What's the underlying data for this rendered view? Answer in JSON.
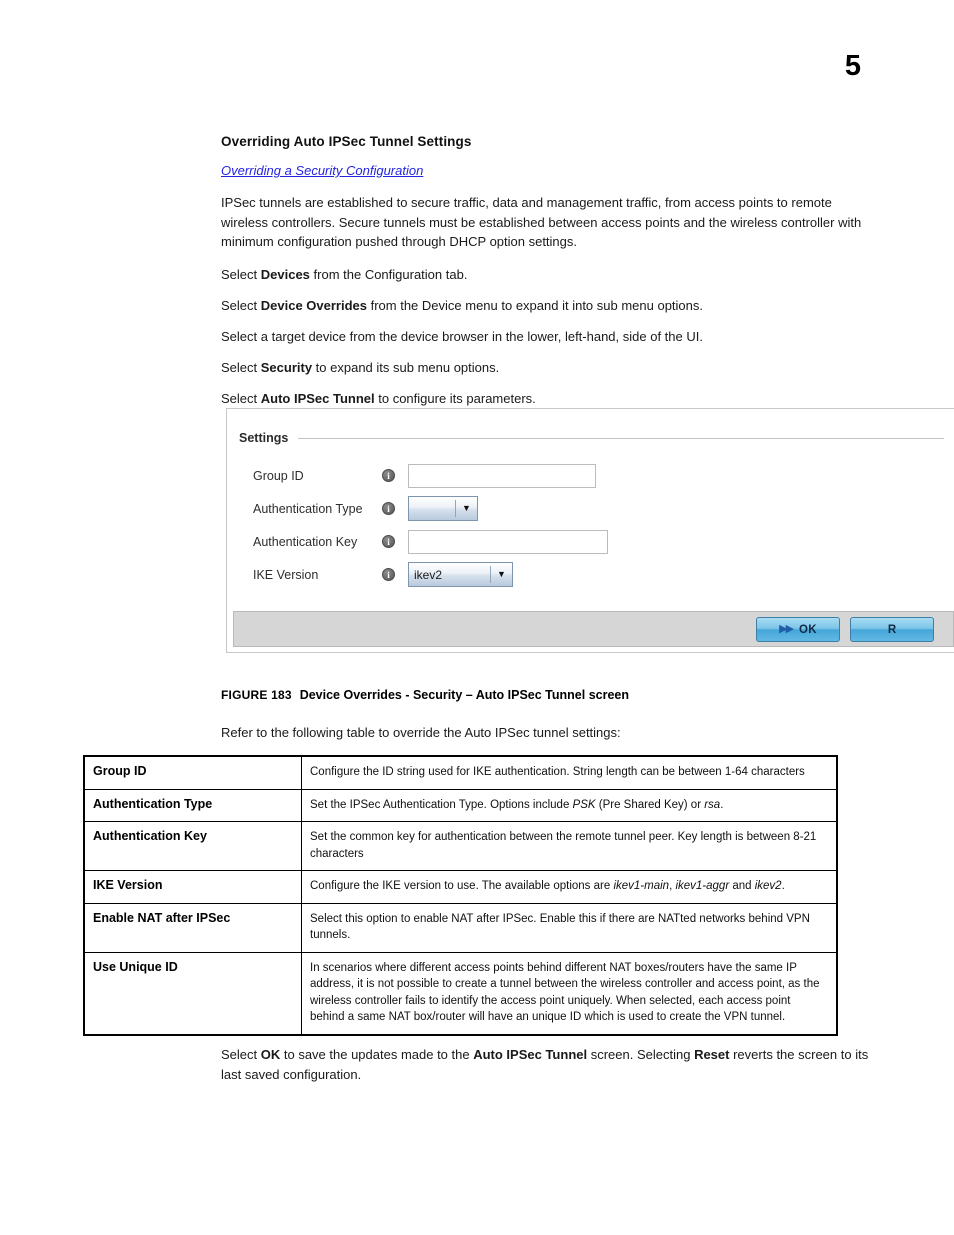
{
  "page": {
    "number": "5"
  },
  "section": {
    "heading": "Overriding Auto IPSec Tunnel Settings",
    "xref_link": "Overriding a Security Configuration",
    "intro_paragraph": "IPSec tunnels are established to secure traffic, data and management traffic, from access points to remote wireless controllers. Secure tunnels must be established between access points and the wireless controller with minimum configuration pushed through DHCP option settings.",
    "steps": [
      {
        "prefix": "Select ",
        "bold": "Devices",
        "suffix": " from the Configuration tab."
      },
      {
        "prefix": "Select ",
        "bold": "Device Overrides",
        "suffix": " from the Device menu to expand it into sub menu options."
      },
      {
        "prefix": "Select a target device from the device browser in the lower, left-hand, side of the UI.",
        "bold": "",
        "suffix": ""
      },
      {
        "prefix": "Select ",
        "bold": "Security",
        "suffix": " to expand its sub menu options."
      },
      {
        "prefix": "Select ",
        "bold": "Auto IPSec Tunnel",
        "suffix": " to configure its parameters."
      }
    ]
  },
  "ui_screenshot": {
    "panel_title": "Settings",
    "fields": [
      {
        "label": "Group ID",
        "icon": "info-icon",
        "control": "text-input",
        "value": "",
        "placeholder": ""
      },
      {
        "label": "Authentication Type",
        "icon": "info-icon",
        "control": "dropdown",
        "value": "",
        "arrow": "▼"
      },
      {
        "label": "Authentication Key",
        "icon": "info-icon",
        "control": "text-input",
        "value": "",
        "placeholder": ""
      },
      {
        "label": "IKE Version",
        "icon": "info-icon",
        "control": "dropdown",
        "value": "ikev2",
        "arrow": "▼"
      }
    ],
    "footer": {
      "ok_label": "OK",
      "ok_icon": "double-chevron-right-icon",
      "ok_chevrons": "▶▶",
      "reset_label": "R",
      "reset_chevrons": ""
    },
    "info_glyph": "i",
    "colors": {
      "link_blue": "#2424e0",
      "button_blue": "#45a6d8",
      "footer_gray": "#d6d6d6",
      "panel_border": "#c8c8c8"
    }
  },
  "figure": {
    "number": "FIGURE 183",
    "title": "Device Overrides - Security – Auto IPSec Tunnel screen",
    "refer_text": "Refer to the following table to override the Auto IPSec tunnel settings:"
  },
  "table": {
    "rows": [
      {
        "term": "Group ID",
        "desc_html": "Configure the ID string used for IKE authentication. String length can be between 1-64 characters"
      },
      {
        "term": "Authentication Type",
        "desc_html": "Set the IPSec Authentication Type. Options include <i>PSK</i> (Pre Shared Key) or <i>rsa</i>."
      },
      {
        "term": "Authentication Key",
        "desc_html": "Set the common key for authentication between the remote tunnel peer. Key length is between 8-21 characters"
      },
      {
        "term": "IKE Version",
        "desc_html": "Configure the IKE version to use. The available options are <i>ikev1-main</i>, <i>ikev1-aggr</i> and <i>ikev2</i>."
      },
      {
        "term": "Enable NAT after IPSec",
        "desc_html": "Select this option to enable NAT after IPSec. Enable this if there are NATted networks behind VPN tunnels."
      },
      {
        "term": "Use Unique ID",
        "desc_html": "In scenarios where different access points behind different NAT boxes/routers have the same IP address, it is not possible to create a tunnel between the wireless controller and access point, as the wireless controller fails to identify the access point uniquely. When selected, each access point behind a same NAT box/router will have an unique ID which is used to create the VPN tunnel."
      }
    ]
  },
  "closing": {
    "html": "Select <b>OK</b> to save the updates made to the <b>Auto IPSec Tunnel</b> screen. Selecting <b>Reset</b> reverts the screen to its last saved configuration."
  }
}
